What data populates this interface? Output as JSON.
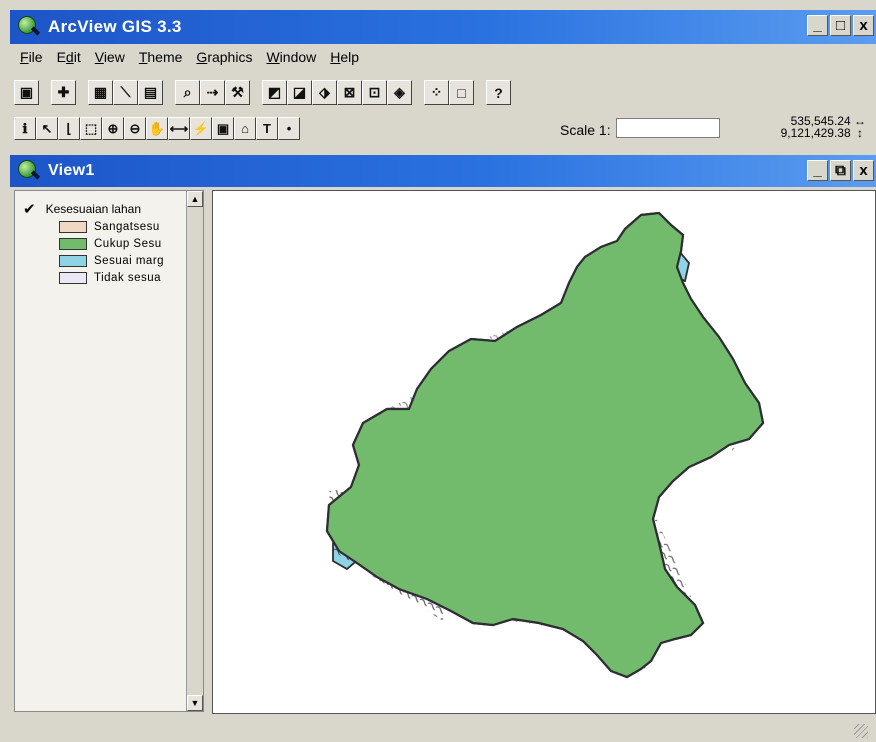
{
  "app": {
    "title": "ArcView GIS 3.3",
    "window_buttons": [
      "_",
      "□",
      "x"
    ]
  },
  "menu": [
    {
      "pre": "",
      "u": "F",
      "post": "ile"
    },
    {
      "pre": "E",
      "u": "d",
      "post": "it"
    },
    {
      "pre": "",
      "u": "V",
      "post": "iew"
    },
    {
      "pre": "",
      "u": "T",
      "post": "heme"
    },
    {
      "pre": "",
      "u": "G",
      "post": "raphics"
    },
    {
      "pre": "",
      "u": "W",
      "post": "indow"
    },
    {
      "pre": "",
      "u": "H",
      "post": "elp"
    }
  ],
  "toolbar1": [
    {
      "name": "save-icon",
      "glyph": "▣"
    },
    {
      "name": "add-theme-icon",
      "glyph": "✚"
    },
    {
      "name": "theme-properties-icon",
      "glyph": "▦"
    },
    {
      "name": "edit-legend-icon",
      "glyph": "⟍"
    },
    {
      "name": "open-table-icon",
      "glyph": "▤"
    },
    {
      "name": "find-icon",
      "glyph": "⌕"
    },
    {
      "name": "locate-address-icon",
      "glyph": "⇢"
    },
    {
      "name": "query-builder-icon",
      "glyph": "⚒"
    },
    {
      "name": "zoom-full-extent-icon",
      "glyph": "◩"
    },
    {
      "name": "zoom-active-themes-icon",
      "glyph": "◪"
    },
    {
      "name": "zoom-selected-icon",
      "glyph": "⬗"
    },
    {
      "name": "zoom-in-fixed-icon",
      "glyph": "⊠"
    },
    {
      "name": "zoom-out-fixed-icon",
      "glyph": "⊡"
    },
    {
      "name": "zoom-previous-icon",
      "glyph": "◈"
    },
    {
      "name": "select-features-icon",
      "glyph": "⁘"
    },
    {
      "name": "clear-selection-icon",
      "glyph": "□"
    },
    {
      "name": "help-icon",
      "glyph": "?"
    }
  ],
  "toolbar2": [
    {
      "name": "identify-icon",
      "glyph": "ℹ"
    },
    {
      "name": "pointer-icon",
      "glyph": "↖"
    },
    {
      "name": "vertex-edit-icon",
      "glyph": "⌊"
    },
    {
      "name": "select-feature-icon",
      "glyph": "⬚"
    },
    {
      "name": "zoom-in-icon",
      "glyph": "⊕"
    },
    {
      "name": "zoom-out-icon",
      "glyph": "⊖"
    },
    {
      "name": "pan-icon",
      "glyph": "✋"
    },
    {
      "name": "measure-icon",
      "glyph": "⟷"
    },
    {
      "name": "hotlink-icon",
      "glyph": "⚡"
    },
    {
      "name": "area-of-interest-icon",
      "glyph": "▣"
    },
    {
      "name": "label-icon",
      "glyph": "⌂"
    },
    {
      "name": "text-icon",
      "glyph": "T"
    },
    {
      "name": "draw-point-icon",
      "glyph": "•"
    }
  ],
  "scale": {
    "label": "Scale 1:",
    "value": ""
  },
  "coordinates": {
    "x": "535,545.24",
    "y": "9,121,429.38"
  },
  "view": {
    "title": "View1",
    "window_buttons": [
      "_",
      "⧉",
      "x"
    ]
  },
  "toc": {
    "theme_name": "Kesesuaian lahan",
    "legend": [
      {
        "label": "Sangatsesu",
        "color": "#f1d8c2"
      },
      {
        "label": "Cukup Sesu",
        "color": "#73bb6c"
      },
      {
        "label": "Sesuai marg",
        "color": "#8fd3e4"
      },
      {
        "label": "Tidak sesua",
        "color": "#ebe8f6"
      }
    ]
  },
  "map": {
    "fill_colors": {
      "cukup_sesuai": "#73bb6c",
      "sesuai_marginal": "#8fd3e4",
      "outline": "#2d2d33"
    }
  }
}
